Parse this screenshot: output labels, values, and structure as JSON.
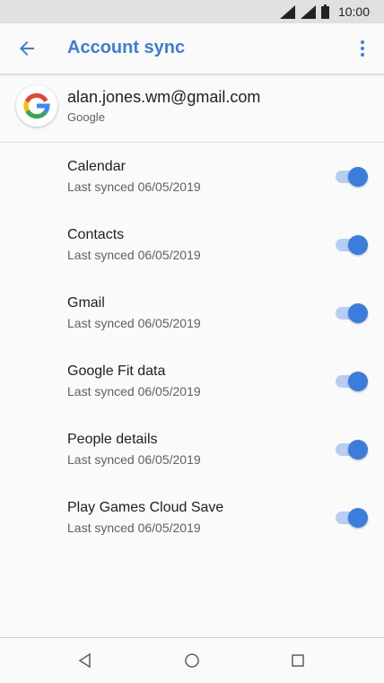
{
  "status_bar": {
    "time": "10:00"
  },
  "app_bar": {
    "title": "Account sync"
  },
  "account": {
    "email": "alan.jones.wm@gmail.com",
    "type": "Google"
  },
  "items": [
    {
      "title": "Calendar",
      "subtitle": "Last synced 06/05/2019",
      "enabled": true
    },
    {
      "title": "Contacts",
      "subtitle": "Last synced 06/05/2019",
      "enabled": true
    },
    {
      "title": "Gmail",
      "subtitle": "Last synced 06/05/2019",
      "enabled": true
    },
    {
      "title": "Google Fit data",
      "subtitle": "Last synced 06/05/2019",
      "enabled": true
    },
    {
      "title": "People details",
      "subtitle": "Last synced 06/05/2019",
      "enabled": true
    },
    {
      "title": "Play Games Cloud Save",
      "subtitle": "Last synced 06/05/2019",
      "enabled": true
    }
  ],
  "colors": {
    "accent": "#3b7ddd",
    "track": "#b7cdf3",
    "background": "#fafafa"
  },
  "icons": {
    "status": [
      "wifi-signal-icon",
      "cell-signal-icon",
      "battery-icon"
    ],
    "app_bar": [
      "back-arrow-icon",
      "more-vert-icon"
    ],
    "account": "google-logo-icon",
    "navigation": [
      "nav-back-icon",
      "nav-home-icon",
      "nav-recents-icon"
    ]
  }
}
